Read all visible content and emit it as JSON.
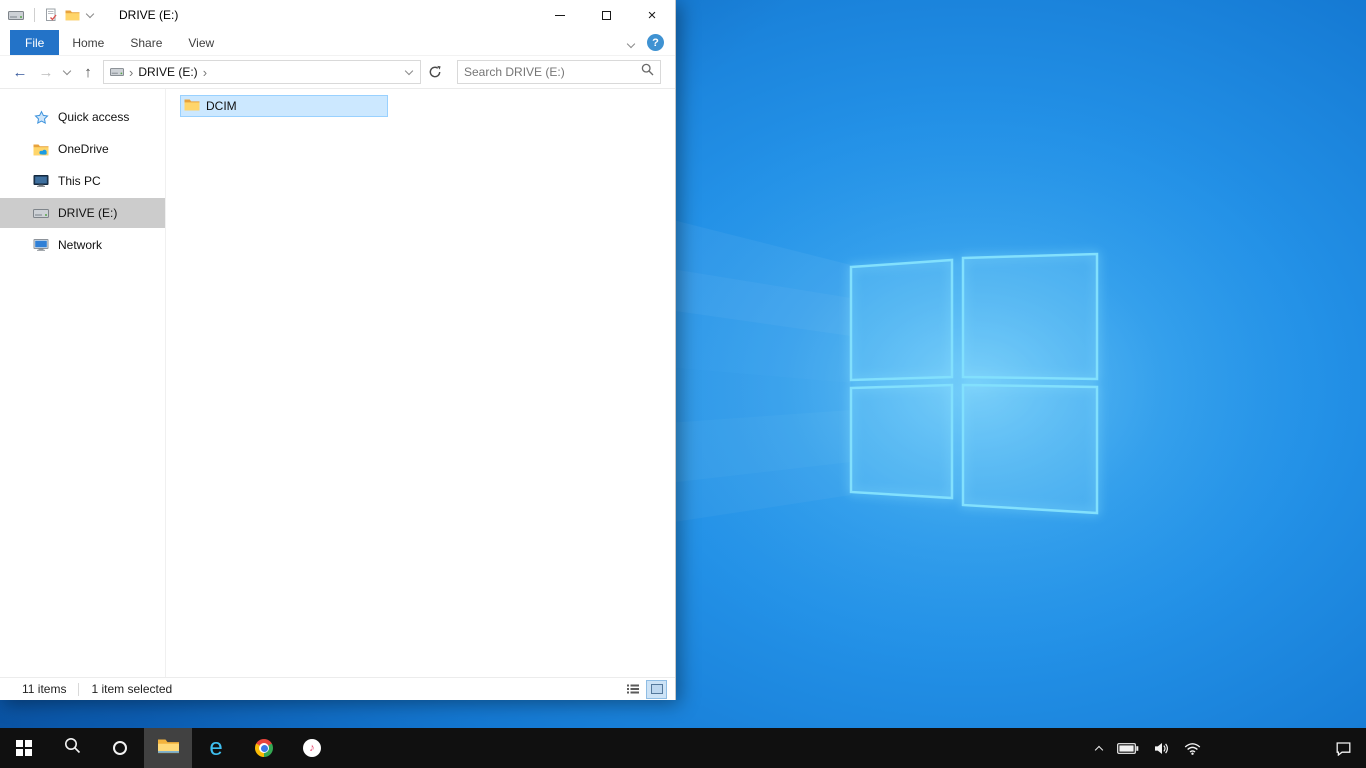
{
  "colors": {
    "accent_blue": "#2373c8",
    "selection_fill": "#cce8ff",
    "selection_border": "#99d1ff",
    "sidebar_selected": "#cccccc",
    "taskbar_bg": "#101010"
  },
  "window": {
    "title": "DRIVE (E:)",
    "ribbon": {
      "file": "File",
      "home": "Home",
      "share": "Share",
      "view": "View",
      "help": "?"
    },
    "address": {
      "root": "DRIVE (E:)",
      "search_placeholder": "Search DRIVE (E:)"
    },
    "sidebar": {
      "items": [
        {
          "label": "Quick access"
        },
        {
          "label": "OneDrive"
        },
        {
          "label": "This PC"
        },
        {
          "label": "DRIVE (E:)"
        },
        {
          "label": "Network"
        }
      ]
    },
    "content": {
      "items": [
        {
          "label": "DCIM"
        }
      ]
    },
    "status": {
      "items_count": "11 items",
      "selection": "1 item selected"
    }
  },
  "icons": {
    "close": "×",
    "back": "←",
    "forward": "→",
    "up": "↑",
    "breadcrumb_sep": "›",
    "ie_letter": "e",
    "itunes_note": "♪"
  }
}
